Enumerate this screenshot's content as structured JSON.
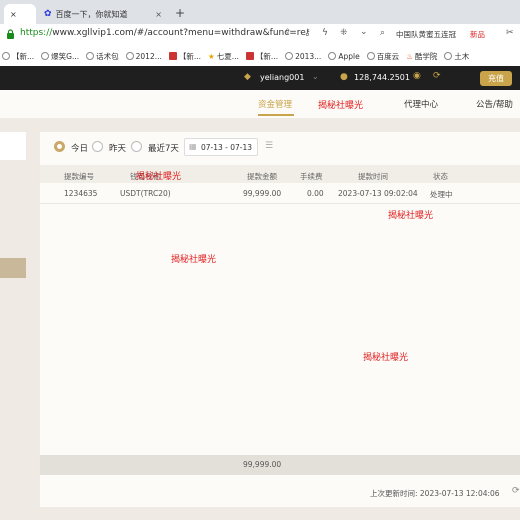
{
  "browser": {
    "tabs": [
      {
        "label": "×",
        "active": true
      },
      {
        "label": "百度一下，你就知道",
        "active": false
      }
    ],
    "new_tab_label": "+",
    "url_scheme": "https://",
    "url_rest": "www.xgllvip1.com/#/account?menu=withdraw&func=re",
    "search_box": "中国队黄蜜五连冠",
    "search_hot": "新品",
    "bookmarks": [
      "【新...",
      "爆笑G...",
      "话术包",
      "2012...",
      "【新...",
      "七夏...",
      "【新...",
      "2013...",
      "Apple",
      "百度云",
      "酷学院",
      "土木"
    ]
  },
  "topbar": {
    "username": "yeliang001",
    "balance": "128,744.2501",
    "recharge_label": "充值"
  },
  "nav": {
    "items": [
      "资金管理",
      "揭秘社曝光",
      "代理中心",
      "公告/帮助"
    ]
  },
  "filter": {
    "options": [
      "今日",
      "昨天",
      "最近7天"
    ],
    "selected": "今日",
    "date_range": "07-13 - 07-13"
  },
  "table": {
    "headers": [
      "提款编号",
      "钱包名称",
      "提款金额",
      "手续费",
      "提款时间",
      "状态"
    ],
    "rows": [
      {
        "id": "1234635",
        "wallet": "USDT(TRC20)",
        "amount": "99,999.00",
        "fee": "0.00",
        "time": "2023-07-13 09:02:04",
        "status": "处理中"
      }
    ],
    "total_amount": "99,999.00"
  },
  "footer": {
    "last_update": "上次更新时间: 2023-07-13 12:04:06"
  },
  "watermarks": [
    "揭秘社曝光",
    "揭秘社曝光",
    "揭秘社曝光",
    "揭秘社曝光"
  ],
  "colors": {
    "gold": "#c9a44a",
    "watermark": "#e02020",
    "topbar": "#1f1f1f"
  }
}
